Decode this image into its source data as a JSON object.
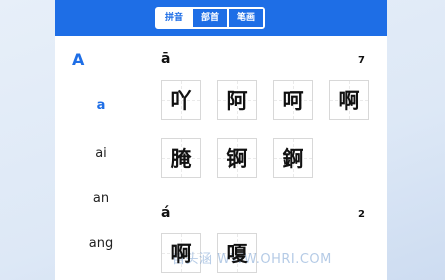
{
  "tabs": [
    "拼音",
    "部首",
    "笔画"
  ],
  "sidebar": {
    "letter": "A",
    "items": [
      "a",
      "ai",
      "an",
      "ang"
    ]
  },
  "sections": [
    {
      "title": "ā",
      "count": "7",
      "chars": [
        "吖",
        "阿",
        "呵",
        "啊",
        "腌",
        "锕",
        "錒"
      ]
    },
    {
      "title": "á",
      "count": "2",
      "chars": [
        "啊",
        "嗄"
      ]
    }
  ],
  "watermark": "自头涵 WWW.OHRI.COM",
  "colors": {
    "accent": "#1e6ee6"
  }
}
